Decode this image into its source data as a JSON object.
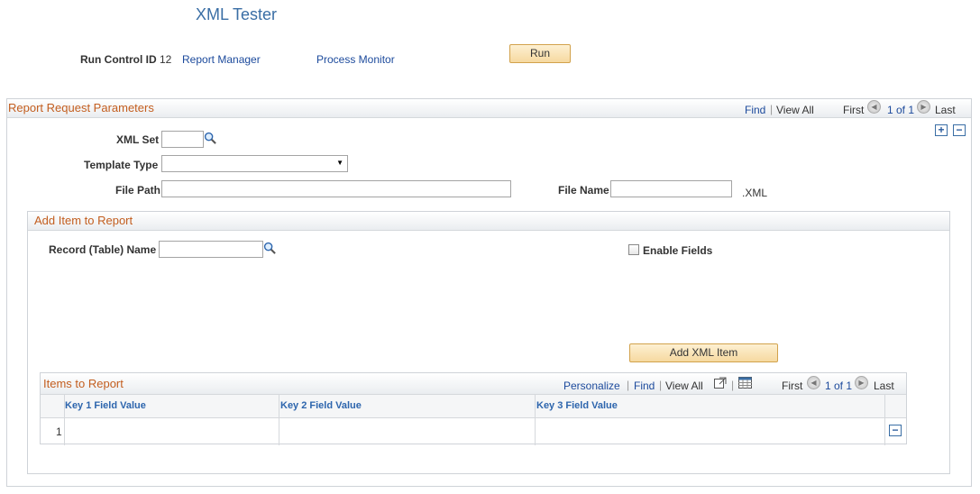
{
  "page": {
    "title": "XML Tester"
  },
  "header": {
    "run_control_label": "Run Control ID",
    "run_control_value": "12",
    "report_manager_link": "Report Manager",
    "process_monitor_link": "Process Monitor",
    "run_button": "Run"
  },
  "params": {
    "title": "Report Request Parameters",
    "find": "Find",
    "view_all": "View All",
    "first": "First",
    "pager": "1 of 1",
    "last": "Last",
    "xml_set_label": "XML Set",
    "xml_set_value": "",
    "template_type_label": "Template Type",
    "template_type_value": "",
    "file_path_label": "File Path",
    "file_path_value": "",
    "file_name_label": "File Name",
    "file_name_value": "",
    "file_ext": ".XML"
  },
  "add_item": {
    "title": "Add Item to Report",
    "record_label": "Record (Table) Name",
    "record_value": "",
    "enable_fields_label": "Enable Fields",
    "add_button": "Add XML Item"
  },
  "items": {
    "title": "Items to Report",
    "personalize": "Personalize",
    "find": "Find",
    "view_all": "View All",
    "first": "First",
    "pager": "1 of 1",
    "last": "Last",
    "columns": [
      "Key 1 Field Value",
      "Key 2 Field Value",
      "Key 3 Field Value"
    ],
    "rows": [
      {
        "num": "1",
        "k1": "",
        "k2": "",
        "k3": ""
      }
    ]
  }
}
